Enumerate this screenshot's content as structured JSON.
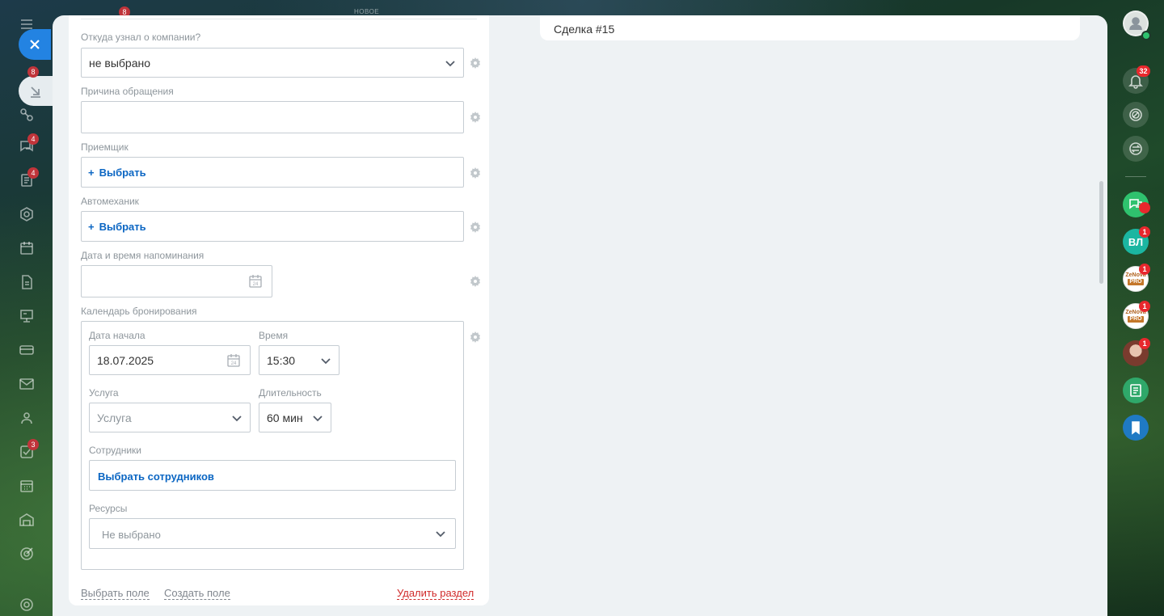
{
  "background_top": {
    "ghost_label": "НОВОЕ",
    "ghost_badge": "8"
  },
  "left_nav": {
    "badges": {
      "feed": "8",
      "chats": "4",
      "tasks_doc": "4",
      "tasks": "3"
    },
    "icons": [
      "menu-icon",
      "feed-icon",
      "crm-icon",
      "chat-icon",
      "documents-icon",
      "sites-icon",
      "calendar-icon",
      "file-icon",
      "presentation-icon",
      "payments-icon",
      "mail-icon",
      "contacts-icon",
      "tasks-icon",
      "schedule-icon",
      "warehouse-icon",
      "goals-icon",
      "settings-icon"
    ]
  },
  "deal": {
    "title": "Сделка #15"
  },
  "form": {
    "source_label": "Откуда узнал о компании?",
    "source_value": "не выбрано",
    "reason_label": "Причина обращения",
    "reason_value": "",
    "receiver_label": "Приемщик",
    "receiver_action": "Выбрать",
    "mechanic_label": "Автомеханик",
    "mechanic_action": "Выбрать",
    "reminder_label": "Дата и время напоминания",
    "reminder_value": "",
    "calendar_icon_day": "24",
    "booking": {
      "label": "Календарь бронирования",
      "start_date_label": "Дата начала",
      "start_date_value": "18.07.2025",
      "time_label": "Время",
      "time_value": "15:30",
      "service_label": "Услуга",
      "service_placeholder": "Услуга",
      "duration_label": "Длительность",
      "duration_value": "60 мин",
      "staff_label": "Сотрудники",
      "staff_action": "Выбрать сотрудников",
      "resources_label": "Ресурсы",
      "resources_value": "Не выбрано"
    },
    "footer": {
      "select_field": "Выбрать поле",
      "create_field": "Создать поле",
      "delete_section": "Удалить раздел"
    }
  },
  "right_rail": {
    "notifications_badge": "32",
    "avatar_vl_initials": "ВЛ",
    "avatar_vl_badge": "1",
    "zenova_badge_1": "1",
    "zenova_badge_2": "1",
    "photo_badge": "1",
    "zenova_text": "ZeNova",
    "zenova_pro": "PRO"
  },
  "colors": {
    "accent": "#2383e2",
    "link": "#0b66c3",
    "danger": "#d02a2a",
    "badge": "#e8282d"
  }
}
